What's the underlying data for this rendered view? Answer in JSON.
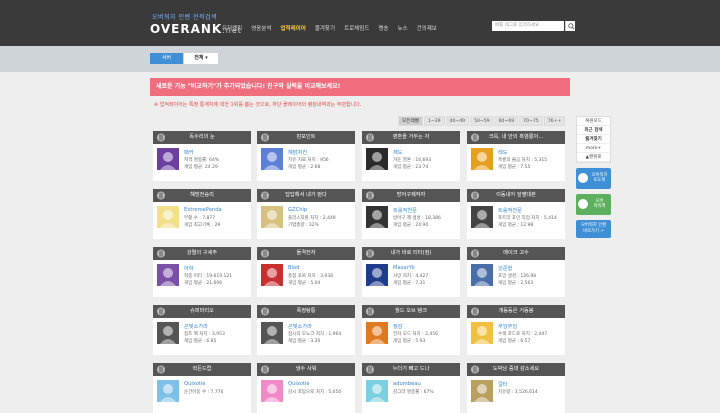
{
  "header": {
    "tagline": "오버워치 인벤 전적검색",
    "logo": "OVERANK",
    "logo_suffix": ".net",
    "nav": [
      "유저랭킹",
      "영웅분석",
      "업적레이어",
      "즐겨찾기",
      "트로체밈드",
      "랭송",
      "뉴스",
      "건의제보"
    ],
    "active_nav_index": 2,
    "search_placeholder": "배틀 태그를 입력하세요"
  },
  "tabs": {
    "tab1": "서버",
    "tab2": "전체 ▾"
  },
  "notice": "새로운 기능 \"비교하기\"가 추가되었습니다! 친구와 실력을 비교해보세요!",
  "note": "※ 업적레이어는 특정 통계치에 대한 1위를 뽑는 것으로, 하단 플레이어의 랭킹내역과는 무관합니다.",
  "filters": [
    "모든레벨",
    "1~39",
    "40~49",
    "50~59",
    "60~69",
    "70~75",
    "76++"
  ],
  "cards": [
    {
      "title": "독수리의 눈",
      "name": "패커",
      "s1": "저격 명중률: 64%",
      "s2": "게임 평균: 24.29",
      "color": "#6b3fa0",
      "icon": "eye-icon"
    },
    {
      "title": "핀포인트",
      "name": "해맑치킨",
      "s1": "치유 치료 처치 : 956",
      "s2": "게임 평균 : 2.68",
      "color": "#5c7fd8",
      "icon": "pin-icon"
    },
    {
      "title": "영혼을 거두는 자",
      "name": "체도",
      "s1": "거둔 영혼 : 16,693",
      "s2": "게임 평균 : 23.74",
      "color": "#2b2b2b",
      "icon": "soul-icon"
    },
    {
      "title": "크윽, 내 안의 흑염룡이...",
      "name": "레도",
      "s1": "흑룡의 불곰 처치 : 5,315",
      "s2": "게임 평균 : 7.55",
      "color": "#e6a020",
      "icon": "dragon-icon"
    },
    {
      "title": "해방전승리",
      "name": "ExtremePanda",
      "s1": "부활 수 : 7,877",
      "s2": "게임 최고기록 : 29",
      "color": "#f2e08a",
      "icon": "angel-icon"
    },
    {
      "title": "답답해서 내가 뛴다",
      "name": "GZChip",
      "s1": "플러스지원 처치 : 2,449",
      "s2": "기엽총량 : 32%",
      "color": "#d8c080",
      "icon": "run-icon"
    },
    {
      "title": "방어구제작자",
      "name": "트롤적천문",
      "s1": "방어구 제 생성 : 18,386",
      "s2": "게임 평균 : 24.90",
      "color": "#333333",
      "icon": "armor-icon"
    },
    {
      "title": "이동내어 앞옆대본",
      "name": "트롤적천문",
      "s1": "포트리 포인 직업 처치 : 5,414",
      "s2": "게임 평균 : 12.98",
      "color": "#444444",
      "icon": "sword-icon"
    },
    {
      "title": "강렬의 구세주",
      "name": "아하",
      "s1": "적중 미터 : 19,619,121",
      "s2": "게임 평균 : 21,606",
      "color": "#7a4fa8",
      "icon": "hook-icon"
    },
    {
      "title": "돌격전자",
      "name": "Blod",
      "s1": "총점 포로 처치 : 3,938",
      "s2": "게임 평균 : 5.04",
      "color": "#c83030",
      "icon": "rocket-icon"
    },
    {
      "title": "내가 바로 티타(짐)",
      "name": "MasarYk",
      "s1": "사망 처치 : 4,427",
      "s2": "게임 평균 : 7.31",
      "color": "#1f3b8c",
      "icon": "flag-icon"
    },
    {
      "title": "메이크 고수",
      "name": "갓준형",
      "s1": "포망 생성 : 126.98",
      "s2": "게임 평균 : 2,563",
      "color": "#4a6fa8",
      "icon": "mech-icon"
    },
    {
      "title": "슈퍼마리오",
      "name": "곤빛소가라",
      "s1": "점프 팩 처치 : 3,953",
      "s2": "게임 평균 : 6.85",
      "color": "#555555",
      "icon": "jump-icon"
    },
    {
      "title": "폭정탕통",
      "name": "곤빛소가라",
      "s1": "점시의 도노크 처치 : 1,964",
      "s2": "게임 평균 : 3.20",
      "color": "#555555",
      "icon": "bomb-icon"
    },
    {
      "title": "월드 오브 탱크",
      "name": "정감",
      "s1": "전차 모드 처치 : 2,456",
      "s2": "게임 평균 : 5.93",
      "color": "#e07a20",
      "icon": "tank-icon"
    },
    {
      "title": "개동등은 거동봉",
      "name": "부잉부잉",
      "s1": "수색 포드로 처치 : 2,447",
      "s2": "게임 평균 : 6.57",
      "color": "#f0c040",
      "icon": "drone-icon"
    },
    {
      "title": "학든드랍",
      "name": "Quixotie",
      "s1": "순간이동 수 : 7,776",
      "s2": "",
      "color": "#7fc0e8",
      "icon": "portal-icon"
    },
    {
      "title": "냉수 사워",
      "name": "Quixotie",
      "s1": "감시 포탑으로 처치 : 5,650",
      "s2": "",
      "color": "#f08ac8",
      "icon": "ice-icon"
    },
    {
      "title": "누더기 빼고 드나",
      "name": "adumbeau",
      "s1": "감그라 명중률 : 67%",
      "s2": "",
      "color": "#7ad0e0",
      "icon": "cloud-icon"
    },
    {
      "title": "도박남 중대 감소세요",
      "name": "걸타",
      "s1": "치유량 : 3,526,614",
      "s2": "",
      "color": "#b8a060",
      "icon": "heal-icon"
    }
  ],
  "sidebar": {
    "items": [
      "복원모드",
      "최근 검색",
      "즐겨찾기",
      "more+",
      "▲맨위로"
    ],
    "ad1": "오버워치\n토도위",
    "ad2": "오버\n파워팩",
    "ad3": "오버워치 인벤\n바로가기 ↗"
  }
}
